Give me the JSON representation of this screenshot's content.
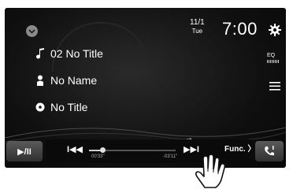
{
  "header": {
    "date": "11/1",
    "day": "Tue",
    "time": "7:00"
  },
  "track": {
    "song": "02 No Title",
    "artist": "No Name",
    "album": "No Title"
  },
  "side": {
    "eq_label": "EQ"
  },
  "controls": {
    "play_pause": "▶/II",
    "prev": "I◀◀",
    "next": "▶▶I",
    "elapsed": "00'33\"",
    "remaining": "-03'11\"",
    "func": "Func.",
    "progress": 0.15
  },
  "icons": [
    "chevron-down-icon",
    "settings-gear-icon",
    "music-note-icon",
    "person-icon",
    "disc-icon",
    "eq-icon",
    "list-icon",
    "repeat-icon",
    "phone-icon",
    "touch-hand-icon"
  ]
}
